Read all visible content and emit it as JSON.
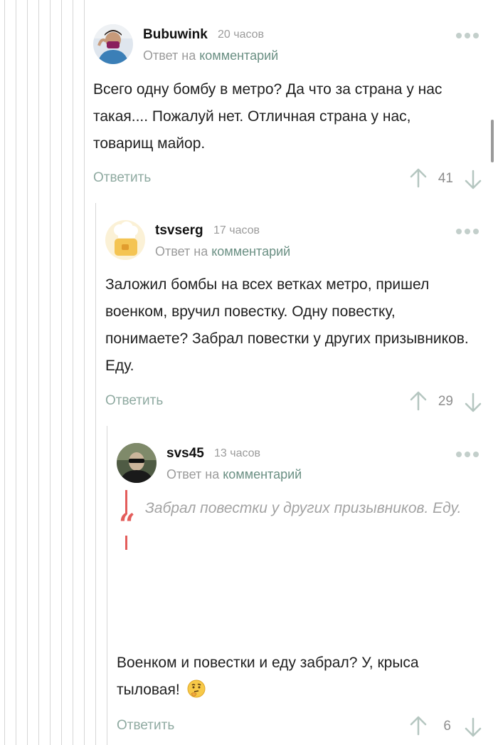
{
  "comments": [
    {
      "username": "Bubuwink",
      "time": "20 часов",
      "reply_prefix": "Ответ на",
      "reply_link": "комментарий",
      "text": "Всего одну бомбу в метро? Да что за страна у нас такая.... Пожалуй нет. Отличная страна у нас, товарищ майор.",
      "reply_label": "Ответить",
      "rating": "41",
      "avatar_icon": "user-avatar-photo-icon"
    },
    {
      "username": "tsvserg",
      "time": "17 часов",
      "reply_prefix": "Ответ на",
      "reply_link": "комментарий",
      "text": "Заложил бомбы на всех ветках метро, пришел военком, вручил повестку. Одну повестку, понимаете? Забрал повестки у других призывников. Еду.",
      "reply_label": "Ответить",
      "rating": "29",
      "avatar_icon": "chef-avatar-icon"
    },
    {
      "username": "svs45",
      "time": "13 часов",
      "reply_prefix": "Ответ на",
      "reply_link": "комментарий",
      "quote": "Забрал повестки у других призывников. Еду.",
      "text": "Военком и повестки и еду забрал? У, крыса тыловая!",
      "emoji": "thinking-face-emoji",
      "reply_label": "Ответить",
      "rating": "6",
      "avatar_icon": "user-avatar-photo-icon"
    }
  ],
  "colors": {
    "accent_link": "#6a8f83",
    "reply_button": "#8faaa1",
    "quote_bar": "#e35d5b",
    "thread_line": "#d6d6d6"
  }
}
